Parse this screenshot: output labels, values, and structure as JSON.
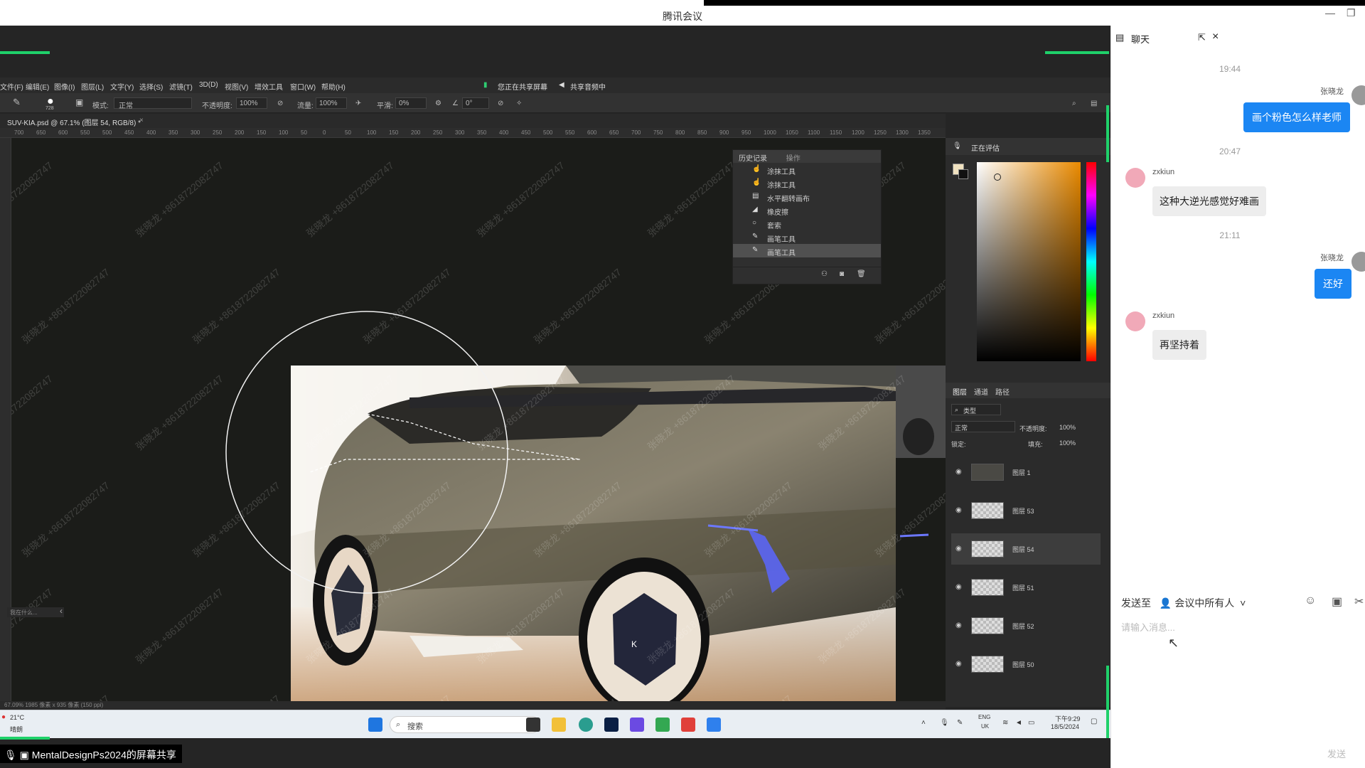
{
  "window": {
    "title": "腾讯会议",
    "minimize_glyph": "—",
    "maximize_glyph": "❐"
  },
  "share": {
    "label": "MentalDesignPs2024的屏幕共享"
  },
  "ps": {
    "menus": [
      "文件(F)",
      "编辑(E)",
      "图像(I)",
      "图层(L)",
      "文字(Y)",
      "选择(S)",
      "滤镜(T)",
      "3D(D)",
      "视图(V)",
      "增效工具",
      "窗口(W)",
      "帮助(H)"
    ],
    "sharing_status": "您正在共享屏幕",
    "audio_status": "共享音频中",
    "options": {
      "brush_size": "728",
      "mode_label": "模式:",
      "mode_value": "正常",
      "opacity_label": "不透明度:",
      "opacity_value": "100%",
      "flow_label": "流量:",
      "flow_value": "100%",
      "smooth_label": "平滑:",
      "smooth_value": "0%",
      "angle_value": "0°"
    },
    "document_tab": "SUV-KIA.psd @ 67.1% (图层 54, RGB/8) *",
    "ruler_ticks": [
      "700",
      "650",
      "600",
      "550",
      "500",
      "450",
      "400",
      "350",
      "300",
      "250",
      "200",
      "150",
      "100",
      "50",
      "0",
      "50",
      "100",
      "150",
      "200",
      "250",
      "300",
      "350",
      "400",
      "450",
      "500",
      "550",
      "600",
      "650",
      "700",
      "750",
      "800",
      "850",
      "900",
      "950",
      "1000",
      "1050",
      "1100",
      "1150",
      "1200",
      "1250",
      "1300",
      "1350"
    ],
    "watermark": "张晓龙 +8618722082747",
    "history": {
      "tabs": [
        "历史记录",
        "操作"
      ],
      "items": [
        "涂抹工具",
        "涂抹工具",
        "水平翻转画布",
        "橡皮擦",
        "套索",
        "画笔工具",
        "画笔工具"
      ]
    },
    "color_header": "正在评估",
    "layer_tabs": [
      "图层",
      "通道",
      "路径"
    ],
    "layer_kind": "类型",
    "blend_mode": "正常",
    "opacity_label": "不透明度:",
    "opacity_value": "100%",
    "lock_label": "锁定:",
    "fill_label": "填充:",
    "fill_value": "100%",
    "layers": [
      "图层 1",
      "图层 53",
      "图层 54",
      "图层 51",
      "图层 52",
      "图层 50"
    ],
    "status": "67.09%   1985 像素 x 935 像素 (150 ppi)",
    "left_hint": "我在什么...",
    "taskbar": {
      "weather_temp": "21°C",
      "weather_desc": "晴朗",
      "search_label": "搜索",
      "lang_top": "ENG",
      "lang_bottom": "UK",
      "time": "下午9:29",
      "date": "18/5/2024"
    }
  },
  "chat": {
    "title": "聊天",
    "messages": [
      {
        "time": "19:44",
        "sender": "张晓龙",
        "text": "画个粉色怎么样老师",
        "mine": true
      },
      {
        "time": "20:47",
        "sender": "zxkiun",
        "text": "这种大逆光感觉好难画",
        "mine": false
      },
      {
        "time": "21:11",
        "sender": "张晓龙",
        "text": "还好",
        "mine": true
      },
      {
        "time": "",
        "sender": "zxkiun",
        "text": "再坚持着",
        "mine": false
      }
    ],
    "send_to_label": "发送至",
    "recipient": "会议中所有人",
    "input_placeholder": "请输入消息...",
    "send_button": "发送"
  },
  "colors": {
    "accent_green": "#1fd16a",
    "chat_bubble_blue": "#1b86f3",
    "ps_background": "#1e1e1e"
  }
}
